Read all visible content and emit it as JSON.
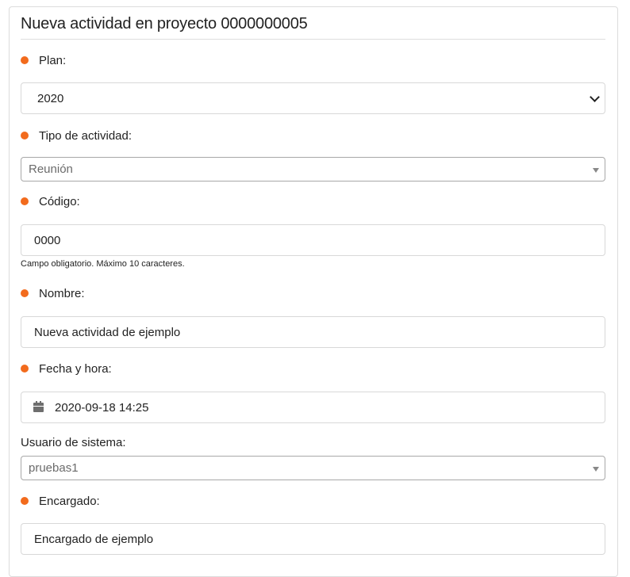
{
  "header": {
    "title": "Nueva actividad en proyecto 0000000005"
  },
  "form": {
    "plan": {
      "label": "Plan:",
      "value": "2020"
    },
    "tipo_actividad": {
      "label": "Tipo de actividad:",
      "value": "Reunión"
    },
    "codigo": {
      "label": "Código:",
      "value": "0000",
      "help": "Campo obligatorio. Máximo 10 caracteres."
    },
    "nombre": {
      "label": "Nombre:",
      "value": "Nueva actividad de ejemplo"
    },
    "fecha_hora": {
      "label": "Fecha y hora:",
      "value": "2020-09-18 14:25",
      "icon": "calendar-icon"
    },
    "usuario_sistema": {
      "label": "Usuario de sistema:",
      "value": "pruebas1"
    },
    "encargado": {
      "label": "Encargado:",
      "value": "Encargado de ejemplo"
    }
  },
  "colors": {
    "required_dot": "#f26b1d",
    "border": "#d8d8d8"
  }
}
